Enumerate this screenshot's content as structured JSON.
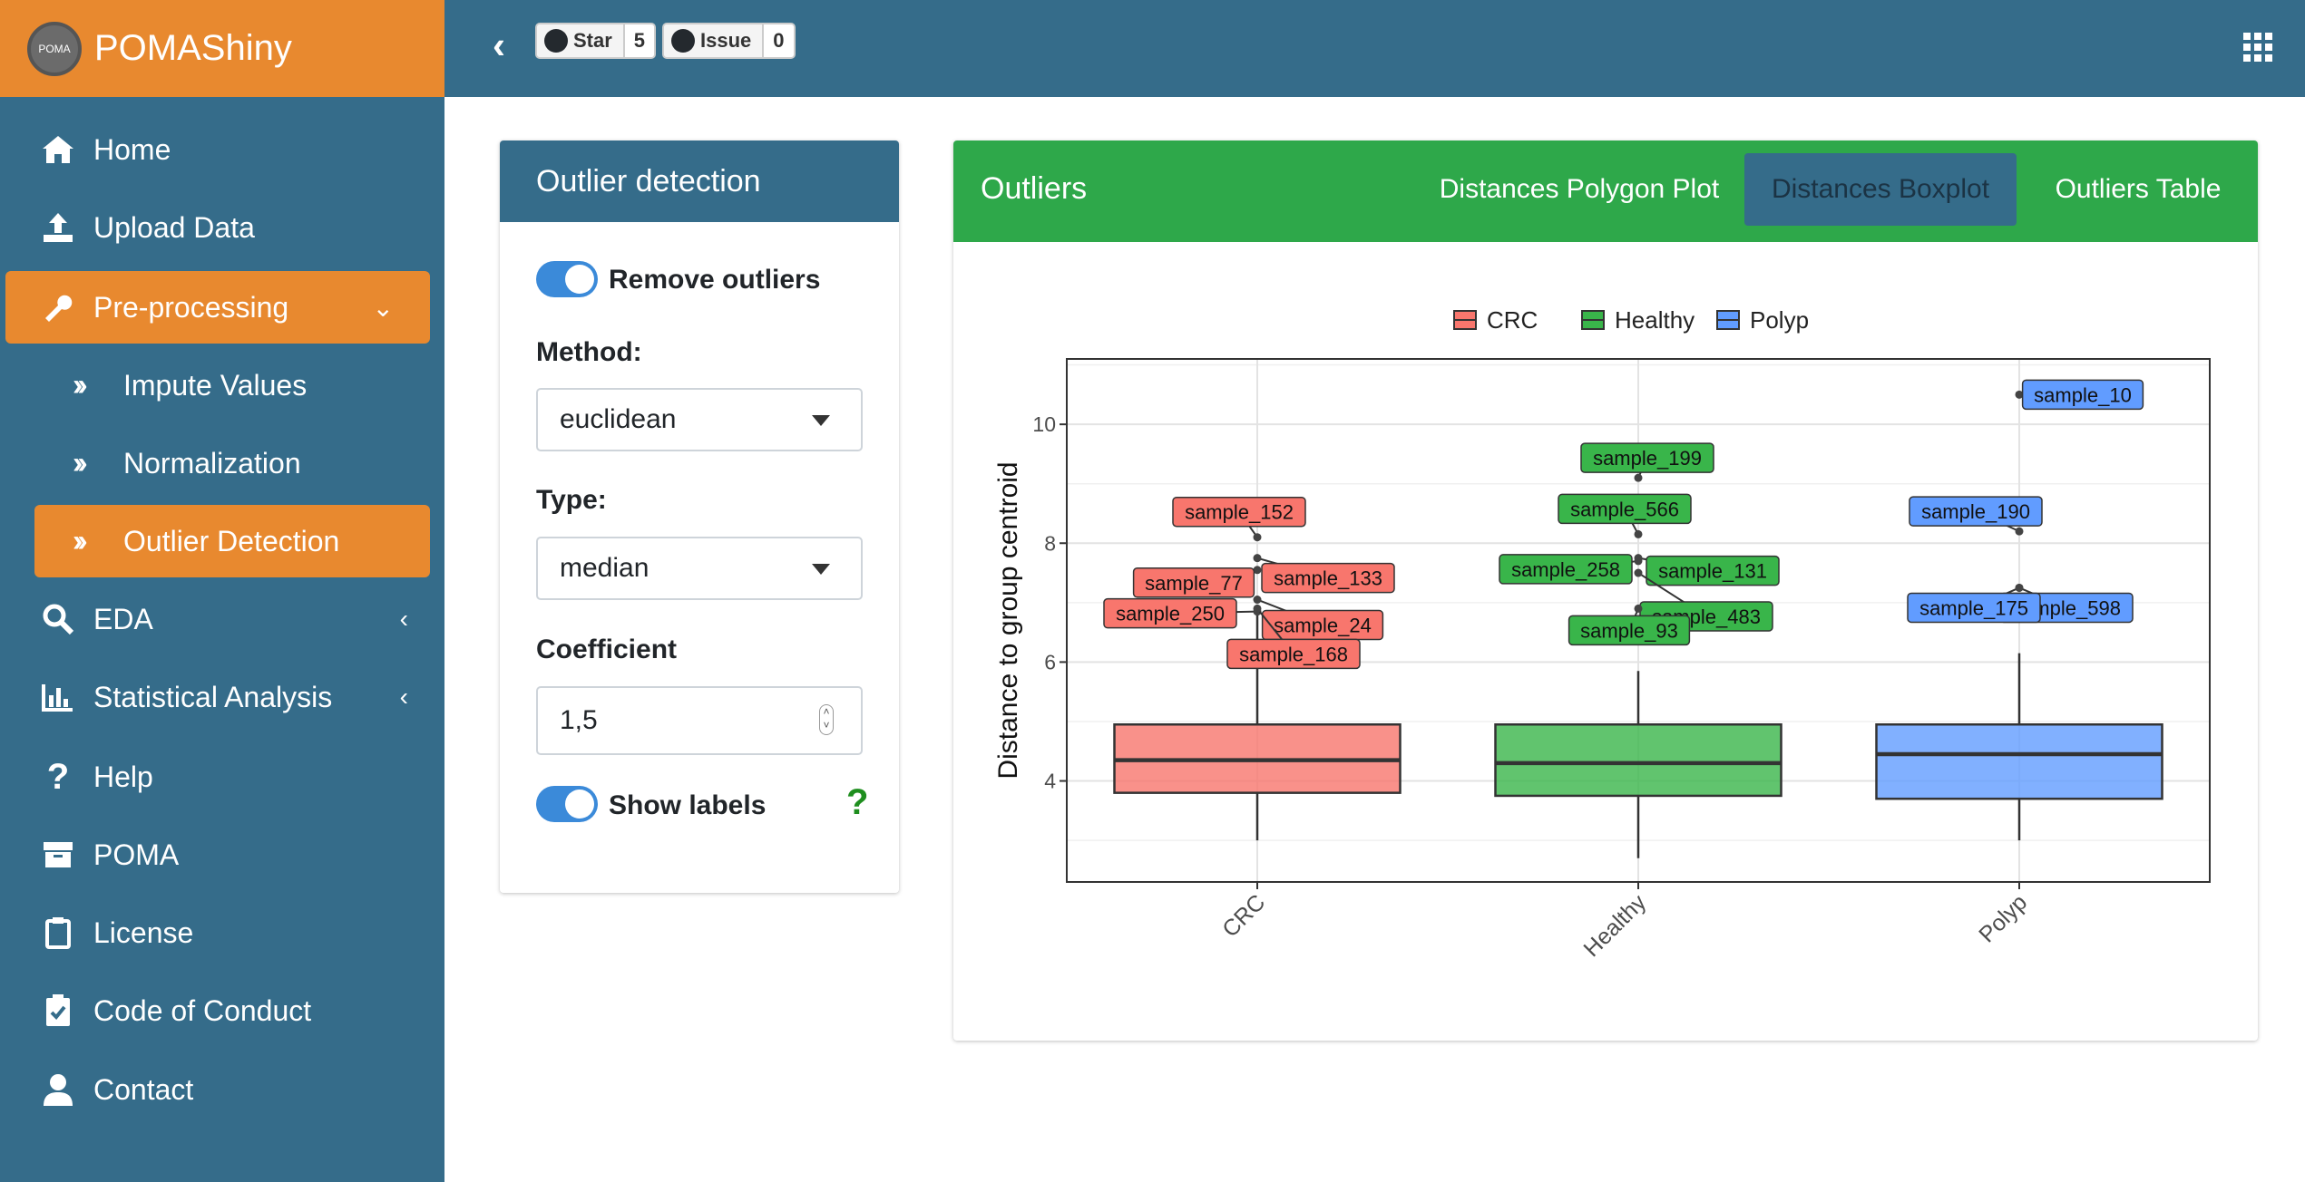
{
  "app": {
    "title": "POMAShiny",
    "logo_text": "POMA"
  },
  "header": {
    "star_label": "Star",
    "star_count": "5",
    "issue_label": "Issue",
    "issue_count": "0"
  },
  "sidebar": {
    "items": [
      {
        "label": "Home",
        "icon": "home-icon"
      },
      {
        "label": "Upload Data",
        "icon": "upload-icon"
      },
      {
        "label": "Pre-processing",
        "icon": "wrench-icon"
      },
      {
        "label": "Impute Values",
        "icon": "double-chevron-right-icon"
      },
      {
        "label": "Normalization",
        "icon": "double-chevron-right-icon"
      },
      {
        "label": "Outlier Detection",
        "icon": "double-chevron-right-icon"
      },
      {
        "label": "EDA",
        "icon": "search-icon"
      },
      {
        "label": "Statistical Analysis",
        "icon": "bar-chart-icon"
      },
      {
        "label": "Help",
        "icon": "question-icon"
      },
      {
        "label": "POMA",
        "icon": "box-icon"
      },
      {
        "label": "License",
        "icon": "clipboard-icon"
      },
      {
        "label": "Code of Conduct",
        "icon": "clipboard-check-icon"
      },
      {
        "label": "Contact",
        "icon": "user-icon"
      }
    ]
  },
  "outlier_panel": {
    "title": "Outlier detection",
    "remove_outliers_label": "Remove outliers",
    "remove_outliers_on": true,
    "method_label": "Method:",
    "method_value": "euclidean",
    "type_label": "Type:",
    "type_value": "median",
    "coefficient_label": "Coefficient",
    "coefficient_value": "1,5",
    "show_labels_label": "Show labels",
    "show_labels_on": true,
    "help_text": "?"
  },
  "outliers_panel": {
    "title": "Outliers",
    "tabs": [
      "Distances Polygon Plot",
      "Distances Boxplot",
      "Outliers Table"
    ],
    "active_tab": "Distances Boxplot"
  },
  "chart_data": {
    "type": "boxplot",
    "ylabel": "Distance to group centroid",
    "xlabel": "",
    "categories": [
      "CRC",
      "Healthy",
      "Polyp"
    ],
    "legend": [
      "CRC",
      "Healthy",
      "Polyp"
    ],
    "legend_position": "top",
    "colors": {
      "CRC": "#f8766d",
      "Healthy": "#39b54a",
      "Polyp": "#619cff"
    },
    "ylim": [
      2.3,
      11.1
    ],
    "yticks": [
      4,
      6,
      8,
      10
    ],
    "grid": true,
    "boxes": [
      {
        "group": "CRC",
        "min": 3.0,
        "q1": 3.8,
        "median": 4.35,
        "q3": 4.95,
        "max": 6.9
      },
      {
        "group": "Healthy",
        "min": 2.7,
        "q1": 3.75,
        "median": 4.3,
        "q3": 4.95,
        "max": 5.85
      },
      {
        "group": "Polyp",
        "min": 3.0,
        "q1": 3.7,
        "median": 4.45,
        "q3": 4.95,
        "max": 6.15
      }
    ],
    "outliers": [
      {
        "group": "CRC",
        "label": "sample_152",
        "y": 8.1
      },
      {
        "group": "CRC",
        "label": "sample_133",
        "y": 7.75
      },
      {
        "group": "CRC",
        "label": "sample_77",
        "y": 7.55
      },
      {
        "group": "CRC",
        "label": "sample_24",
        "y": 7.05
      },
      {
        "group": "CRC",
        "label": "sample_250",
        "y": 6.85
      },
      {
        "group": "CRC",
        "label": "sample_168",
        "y": 6.9
      },
      {
        "group": "Healthy",
        "label": "sample_199",
        "y": 9.1
      },
      {
        "group": "Healthy",
        "label": "sample_566",
        "y": 8.15
      },
      {
        "group": "Healthy",
        "label": "sample_258",
        "y": 7.7
      },
      {
        "group": "Healthy",
        "label": "sample_131",
        "y": 7.75
      },
      {
        "group": "Healthy",
        "label": "sample_483",
        "y": 7.5
      },
      {
        "group": "Healthy",
        "label": "sample_93",
        "y": 6.9
      },
      {
        "group": "Polyp",
        "label": "sample_10",
        "y": 10.5
      },
      {
        "group": "Polyp",
        "label": "sample_190",
        "y": 8.2
      },
      {
        "group": "Polyp",
        "label": "sample_598",
        "y": 7.25
      },
      {
        "group": "Polyp",
        "label": "sample_175",
        "y": 7.25
      }
    ]
  }
}
